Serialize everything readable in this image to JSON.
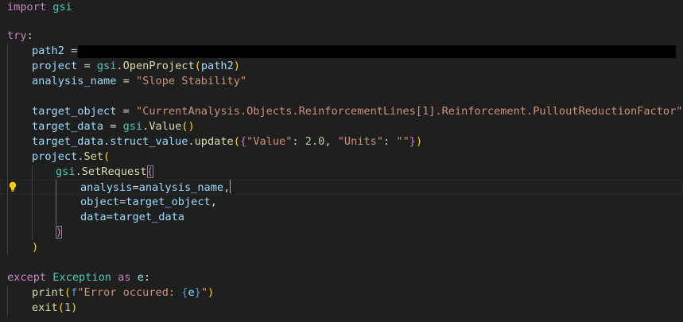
{
  "editor": {
    "theme": {
      "background": "#1f1f1f"
    },
    "lines": {
      "l1": {
        "kw_import": "import",
        "module": "gsi"
      },
      "l3": {
        "kw_try": "try",
        "colon": ":"
      },
      "l4": {
        "var": "path2",
        "eq": " = "
      },
      "l5": {
        "var": "project",
        "eq": " = ",
        "mod": "gsi",
        "dot": ".",
        "fn": "OpenProject",
        "open": "(",
        "arg": "path2",
        "close": ")"
      },
      "l6": {
        "var": "analysis_name",
        "eq": " = ",
        "str": "\"Slope Stability\""
      },
      "l8": {
        "var": "target_object",
        "eq": " = ",
        "str": "\"CurrentAnalysis.Objects.ReinforcementLines[1].Reinforcement.PulloutReductionFactor\""
      },
      "l9": {
        "var": "target_data",
        "eq": " = ",
        "mod": "gsi",
        "dot": ".",
        "fn": "Value",
        "open": "(",
        "close": ")"
      },
      "l10": {
        "var": "target_data",
        "dot1": ".",
        "attr": "struct_value",
        "dot2": ".",
        "fn": "update",
        "open": "(",
        "brace_open": "{",
        "str1": "\"Value\"",
        "colon1": ": ",
        "num": "2.0",
        "comma": ", ",
        "str2": "\"Units\"",
        "colon2": ": ",
        "str3": "\"\"",
        "brace_close": "}",
        "close": ")"
      },
      "l11": {
        "var": "project",
        "dot": ".",
        "fn": "Set",
        "open": "("
      },
      "l12": {
        "mod": "gsi",
        "dot": ".",
        "fn": "SetRequest",
        "open": "("
      },
      "l13": {
        "param": "analysis",
        "eq": "=",
        "value": "analysis_name",
        "comma": ","
      },
      "l14": {
        "param": "object",
        "eq": "=",
        "value": "target_object",
        "comma": ","
      },
      "l15": {
        "param": "data",
        "eq": "=",
        "value": "target_data"
      },
      "l16": {
        "close": ")"
      },
      "l17": {
        "close": ")"
      },
      "l19": {
        "kw_except": "except",
        "cls": "Exception",
        "kw_as": "as",
        "var": "e",
        "colon": ":"
      },
      "l20": {
        "fn": "print",
        "open": "(",
        "fprefix": "f",
        "str_a": "\"Error occured: ",
        "brace_open": "{",
        "var": "e",
        "brace_close": "}",
        "str_b": "\"",
        "close": ")"
      },
      "l21": {
        "fn": "exit",
        "open": "(",
        "num": "1",
        "close": ")"
      }
    },
    "lightbulb": "lightbulb-icon"
  }
}
